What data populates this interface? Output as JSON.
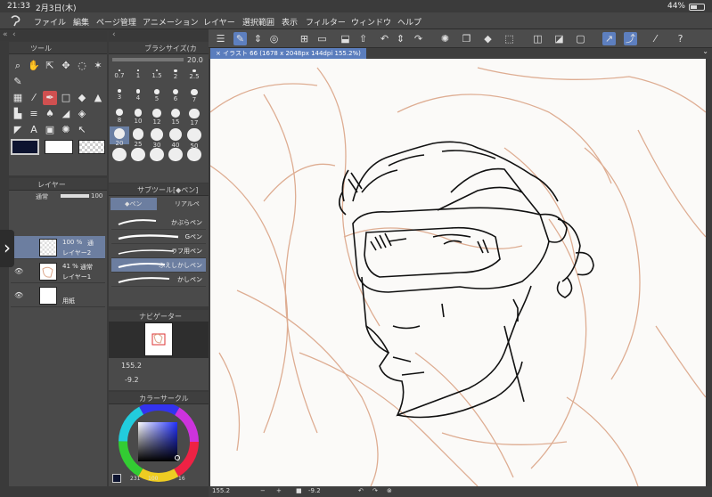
{
  "status": {
    "time": "21:33",
    "date": "2月3日(木)",
    "battery": "44%",
    "battery_level": 0.44
  },
  "menu": [
    "ファイル",
    "編集",
    "ページ管理",
    "アニメーション",
    "レイヤー",
    "選択範囲",
    "表示",
    "フィルター",
    "ウィンドウ",
    "ヘルプ"
  ],
  "panels": {
    "tool": {
      "title": "ツール"
    },
    "brush_size": {
      "title": "ブラシサイズ(カ",
      "value": "20.0",
      "sizes": [
        "0.7",
        "1",
        "1.5",
        "2",
        "2.5",
        "3",
        "4",
        "5",
        "6",
        "7",
        "8",
        "10",
        "12",
        "15",
        "17",
        "20",
        "25",
        "30",
        "40",
        "50",
        "",
        "",
        "",
        "",
        ""
      ]
    },
    "layer": {
      "title": "レイヤー",
      "blend": "通常",
      "opacity": "100",
      "layers": [
        {
          "opacity": "100 %",
          "mode": "通",
          "name": "レイヤー2"
        },
        {
          "opacity": "41 %",
          "mode": "通常",
          "name": "レイヤー1"
        },
        {
          "opacity": "",
          "mode": "",
          "name": "用紙"
        }
      ]
    },
    "subtool": {
      "title": "サブツール[◆ペン]",
      "tabs": [
        "◆ペン",
        "リアルペ"
      ],
      "brushes": [
        "かぶらペン",
        "Gペン",
        "ラフ用ペン",
        "ふえしかしペン",
        "かしペン"
      ]
    },
    "navigator": {
      "title": "ナビゲーター",
      "zoom": "155.2",
      "rotate": "-9.2"
    },
    "color": {
      "title": "カラーサークル",
      "hex": "231",
      "r": "100",
      "b": "16"
    }
  },
  "document_tab": "イラスト 66 (1678 x 2048px 144dpi 155.2%)",
  "bottom": {
    "zoom": "155.2",
    "angle": "-9.2"
  },
  "colors": {
    "main": "#0d1430",
    "sub": "#ffffff",
    "sketch": "#dba588",
    "accent": "#5a7dbd"
  }
}
